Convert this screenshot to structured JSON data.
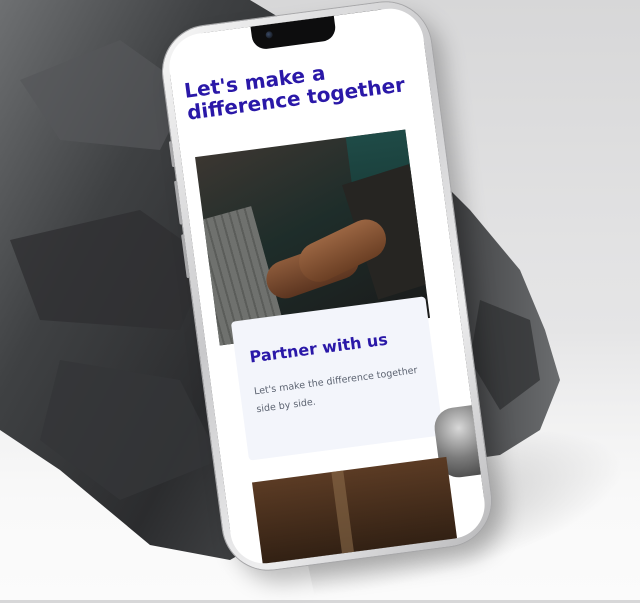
{
  "screen": {
    "headline": "Let's make a difference together",
    "card": {
      "title": "Partner with us",
      "text": "Let's make the difference together side by side."
    }
  },
  "images": {
    "hero": "handshake-photo",
    "secondary": "event-photo"
  },
  "colors": {
    "brand_heading": "#2a18a8",
    "body_text": "#5d6472",
    "card_background": "#f3f5fb",
    "phone_frame": "#d0d0d2",
    "rock": "#3a3b3d"
  }
}
